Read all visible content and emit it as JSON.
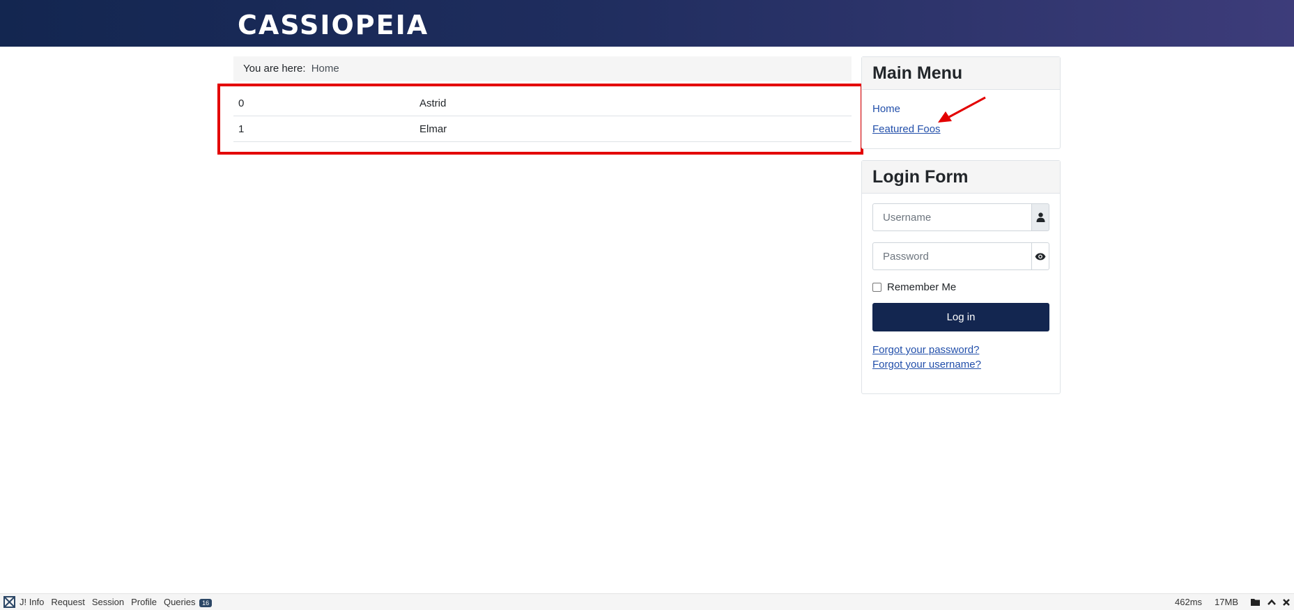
{
  "header": {
    "site_title": "CASSIOPEIA",
    "background": "#132650"
  },
  "breadcrumb": {
    "prefix": "You are here:",
    "items": [
      "Home"
    ]
  },
  "table": {
    "rows": [
      {
        "id": "0",
        "name": "Astrid"
      },
      {
        "id": "1",
        "name": "Elmar"
      }
    ]
  },
  "main_menu": {
    "title": "Main Menu",
    "items": [
      {
        "label": "Home"
      },
      {
        "label": "Featured Foos"
      }
    ]
  },
  "login_form": {
    "title": "Login Form",
    "username_placeholder": "Username",
    "password_placeholder": "Password",
    "remember_label": "Remember Me",
    "login_button": "Log in",
    "forgot_password": "Forgot your password?",
    "forgot_username": "Forgot your username?"
  },
  "debug_bar": {
    "tabs": [
      "J! Info",
      "Request",
      "Session",
      "Profile",
      "Queries"
    ],
    "queries_count": "16",
    "time": "462ms",
    "memory": "17MB"
  },
  "colors": {
    "accent": "#132650",
    "link": "#224faa",
    "highlight": "#e30000"
  },
  "icons": [
    "user-icon",
    "eye-icon",
    "joomla-logo-icon",
    "folder-icon",
    "chevron-up-icon",
    "close-icon"
  ]
}
